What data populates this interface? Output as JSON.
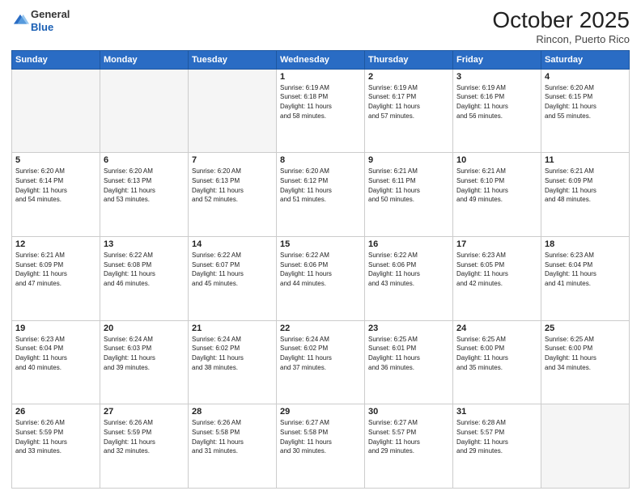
{
  "header": {
    "logo_line1": "General",
    "logo_line2": "Blue",
    "month_title": "October 2025",
    "location": "Rincon, Puerto Rico"
  },
  "days_of_week": [
    "Sunday",
    "Monday",
    "Tuesday",
    "Wednesday",
    "Thursday",
    "Friday",
    "Saturday"
  ],
  "weeks": [
    [
      {
        "day": "",
        "info": ""
      },
      {
        "day": "",
        "info": ""
      },
      {
        "day": "",
        "info": ""
      },
      {
        "day": "1",
        "info": "Sunrise: 6:19 AM\nSunset: 6:18 PM\nDaylight: 11 hours\nand 58 minutes."
      },
      {
        "day": "2",
        "info": "Sunrise: 6:19 AM\nSunset: 6:17 PM\nDaylight: 11 hours\nand 57 minutes."
      },
      {
        "day": "3",
        "info": "Sunrise: 6:19 AM\nSunset: 6:16 PM\nDaylight: 11 hours\nand 56 minutes."
      },
      {
        "day": "4",
        "info": "Sunrise: 6:20 AM\nSunset: 6:15 PM\nDaylight: 11 hours\nand 55 minutes."
      }
    ],
    [
      {
        "day": "5",
        "info": "Sunrise: 6:20 AM\nSunset: 6:14 PM\nDaylight: 11 hours\nand 54 minutes."
      },
      {
        "day": "6",
        "info": "Sunrise: 6:20 AM\nSunset: 6:13 PM\nDaylight: 11 hours\nand 53 minutes."
      },
      {
        "day": "7",
        "info": "Sunrise: 6:20 AM\nSunset: 6:13 PM\nDaylight: 11 hours\nand 52 minutes."
      },
      {
        "day": "8",
        "info": "Sunrise: 6:20 AM\nSunset: 6:12 PM\nDaylight: 11 hours\nand 51 minutes."
      },
      {
        "day": "9",
        "info": "Sunrise: 6:21 AM\nSunset: 6:11 PM\nDaylight: 11 hours\nand 50 minutes."
      },
      {
        "day": "10",
        "info": "Sunrise: 6:21 AM\nSunset: 6:10 PM\nDaylight: 11 hours\nand 49 minutes."
      },
      {
        "day": "11",
        "info": "Sunrise: 6:21 AM\nSunset: 6:09 PM\nDaylight: 11 hours\nand 48 minutes."
      }
    ],
    [
      {
        "day": "12",
        "info": "Sunrise: 6:21 AM\nSunset: 6:09 PM\nDaylight: 11 hours\nand 47 minutes."
      },
      {
        "day": "13",
        "info": "Sunrise: 6:22 AM\nSunset: 6:08 PM\nDaylight: 11 hours\nand 46 minutes."
      },
      {
        "day": "14",
        "info": "Sunrise: 6:22 AM\nSunset: 6:07 PM\nDaylight: 11 hours\nand 45 minutes."
      },
      {
        "day": "15",
        "info": "Sunrise: 6:22 AM\nSunset: 6:06 PM\nDaylight: 11 hours\nand 44 minutes."
      },
      {
        "day": "16",
        "info": "Sunrise: 6:22 AM\nSunset: 6:06 PM\nDaylight: 11 hours\nand 43 minutes."
      },
      {
        "day": "17",
        "info": "Sunrise: 6:23 AM\nSunset: 6:05 PM\nDaylight: 11 hours\nand 42 minutes."
      },
      {
        "day": "18",
        "info": "Sunrise: 6:23 AM\nSunset: 6:04 PM\nDaylight: 11 hours\nand 41 minutes."
      }
    ],
    [
      {
        "day": "19",
        "info": "Sunrise: 6:23 AM\nSunset: 6:04 PM\nDaylight: 11 hours\nand 40 minutes."
      },
      {
        "day": "20",
        "info": "Sunrise: 6:24 AM\nSunset: 6:03 PM\nDaylight: 11 hours\nand 39 minutes."
      },
      {
        "day": "21",
        "info": "Sunrise: 6:24 AM\nSunset: 6:02 PM\nDaylight: 11 hours\nand 38 minutes."
      },
      {
        "day": "22",
        "info": "Sunrise: 6:24 AM\nSunset: 6:02 PM\nDaylight: 11 hours\nand 37 minutes."
      },
      {
        "day": "23",
        "info": "Sunrise: 6:25 AM\nSunset: 6:01 PM\nDaylight: 11 hours\nand 36 minutes."
      },
      {
        "day": "24",
        "info": "Sunrise: 6:25 AM\nSunset: 6:00 PM\nDaylight: 11 hours\nand 35 minutes."
      },
      {
        "day": "25",
        "info": "Sunrise: 6:25 AM\nSunset: 6:00 PM\nDaylight: 11 hours\nand 34 minutes."
      }
    ],
    [
      {
        "day": "26",
        "info": "Sunrise: 6:26 AM\nSunset: 5:59 PM\nDaylight: 11 hours\nand 33 minutes."
      },
      {
        "day": "27",
        "info": "Sunrise: 6:26 AM\nSunset: 5:59 PM\nDaylight: 11 hours\nand 32 minutes."
      },
      {
        "day": "28",
        "info": "Sunrise: 6:26 AM\nSunset: 5:58 PM\nDaylight: 11 hours\nand 31 minutes."
      },
      {
        "day": "29",
        "info": "Sunrise: 6:27 AM\nSunset: 5:58 PM\nDaylight: 11 hours\nand 30 minutes."
      },
      {
        "day": "30",
        "info": "Sunrise: 6:27 AM\nSunset: 5:57 PM\nDaylight: 11 hours\nand 29 minutes."
      },
      {
        "day": "31",
        "info": "Sunrise: 6:28 AM\nSunset: 5:57 PM\nDaylight: 11 hours\nand 29 minutes."
      },
      {
        "day": "",
        "info": ""
      }
    ]
  ]
}
